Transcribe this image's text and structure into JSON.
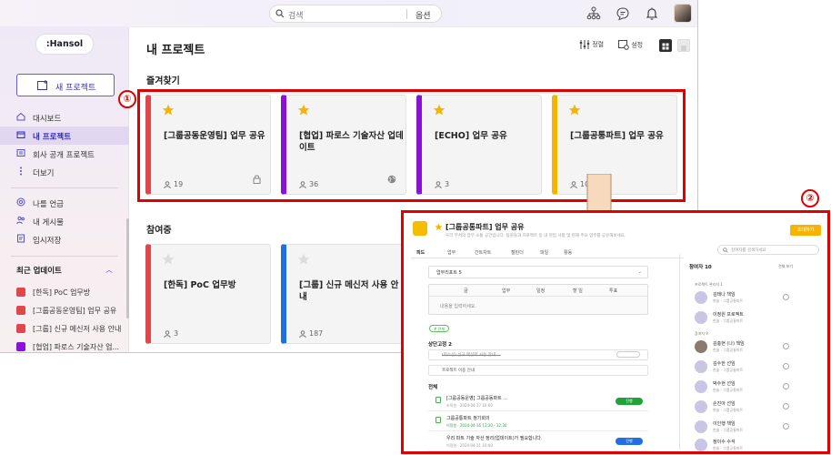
{
  "topbar": {
    "search_placeholder": "검색",
    "search_option": "옵션",
    "icons": [
      "search-icon",
      "org-chart-icon",
      "chat-icon",
      "bell-icon",
      "avatar"
    ]
  },
  "sidebar": {
    "logo": ":Hansol",
    "new_project": "새 프로젝트",
    "nav": [
      {
        "label": "대시보드",
        "icon": "home-icon"
      },
      {
        "label": "내 프로젝트",
        "icon": "folder-icon"
      },
      {
        "label": "회사 공개 프로젝트",
        "icon": "list-icon"
      },
      {
        "label": "더보기",
        "icon": "more-vertical-icon"
      },
      {
        "label": "나를 언급",
        "icon": "at-icon"
      },
      {
        "label": "내 게시물",
        "icon": "people-icon"
      },
      {
        "label": "임시저장",
        "icon": "draft-icon"
      }
    ],
    "recent_title": "최근 업데이트",
    "recent": [
      {
        "label": "[한독] PoC 업무방",
        "color": "#e0474c"
      },
      {
        "label": "[그룹공동운영팀] 업무 공유",
        "color": "#e0474c"
      },
      {
        "label": "[그룹] 신규 메신저 사용 안내",
        "color": "#e0474c"
      },
      {
        "label": "[협업] 파로스 기술자산 업...",
        "color": "#8a12d8"
      }
    ]
  },
  "main": {
    "title": "내 프로젝트",
    "sort_label": "정렬",
    "settings_label": "설정",
    "favorites_title": "즐겨찾기",
    "participating_title": "참여중",
    "favorites": [
      {
        "title": "[그룹공동운영팀] 업무 공유",
        "members": "19",
        "color": "#e0474c"
      },
      {
        "title": "[협업] 파로스 기술자산 업데이트",
        "members": "36",
        "color": "#8a12d8"
      },
      {
        "title": "[ECHO] 업무 공유",
        "members": "3",
        "color": "#8a12d8"
      },
      {
        "title": "[그룹공통파트] 업무 공유",
        "members": "10",
        "color": "#f5b400"
      }
    ],
    "participating": [
      {
        "title": "[한독] PoC 업무방",
        "members": "3",
        "color": "#e0474c"
      },
      {
        "title": "[그룹] 신규 메신저 사용 안내",
        "members": "187",
        "color": "#1f6fe0"
      }
    ]
  },
  "annotations": {
    "one": "①",
    "two": "②"
  },
  "inset": {
    "title": "[그룹공통파트] 업무 공유",
    "description": "우리 부서의 업무 소통 공간입니다. 팀원들과 프로젝트 등 내 현업 사항 및 현재 주요 업무를 공유해보세요.",
    "invite_button": "초대하기",
    "tabs": [
      "피드",
      "업무",
      "간트차트",
      "캘린더",
      "파일",
      "활동"
    ],
    "search_placeholder": "참여자를 검색하세요",
    "select_label": "업무리포트 5",
    "compose_tabs": [
      "글",
      "업무",
      "일정",
      "할 일",
      "투표"
    ],
    "compose_placeholder": "내용을 입력하세요.",
    "chip": "# 전체",
    "pinned_title": "상단고정 2",
    "pinned": [
      "(취소선) 신규 메신저 사용 안내 ...",
      "프로젝트 이용 안내"
    ],
    "all_title": "전체",
    "posts": [
      {
        "title": "[그룹공동운영] 그룹공동파트 ...",
        "sub": "조직원 · 2024-04-17 10:00",
        "badge": "진행",
        "badge_color": "#22a33a"
      },
      {
        "title": "그룹공통파트 정기회의",
        "sub": "이정원 · 2024-04-16 11:30 - 12:30",
        "badge": "",
        "badge_color": ""
      },
      {
        "title": "우리 파트 기술 자산 정리(업데이트)가 필요합니다.",
        "sub": "이정원 · 2024-04-11 10:00",
        "badge": "진행",
        "badge_color": "#1f6fe0"
      }
    ],
    "members_title": "참여자 10",
    "members_all": "전체 보기",
    "group1": "프로젝트 관리자 1",
    "group2": "참여자 9",
    "members": [
      {
        "name": "김태나 책임",
        "dept": "한솔 · 그룹공통파트"
      },
      {
        "name": "이정원 프로젝트",
        "dept": "한솔 · 그룹공통파트"
      },
      {
        "name": "김충현 (나) 책임",
        "dept": "한솔 · 그룹공통파트"
      },
      {
        "name": "김수한 선임",
        "dept": "한솔 · 그룹공통파트"
      },
      {
        "name": "박수현 선임",
        "dept": "한솔 · 그룹공통파트"
      },
      {
        "name": "손진아 선임",
        "dept": "한솔 · 그룹공통파트"
      },
      {
        "name": "이인행 책임",
        "dept": "한솔 · 그룹공통파트"
      },
      {
        "name": "정이수 수석",
        "dept": "한솔 · 그룹공통파트"
      }
    ]
  }
}
